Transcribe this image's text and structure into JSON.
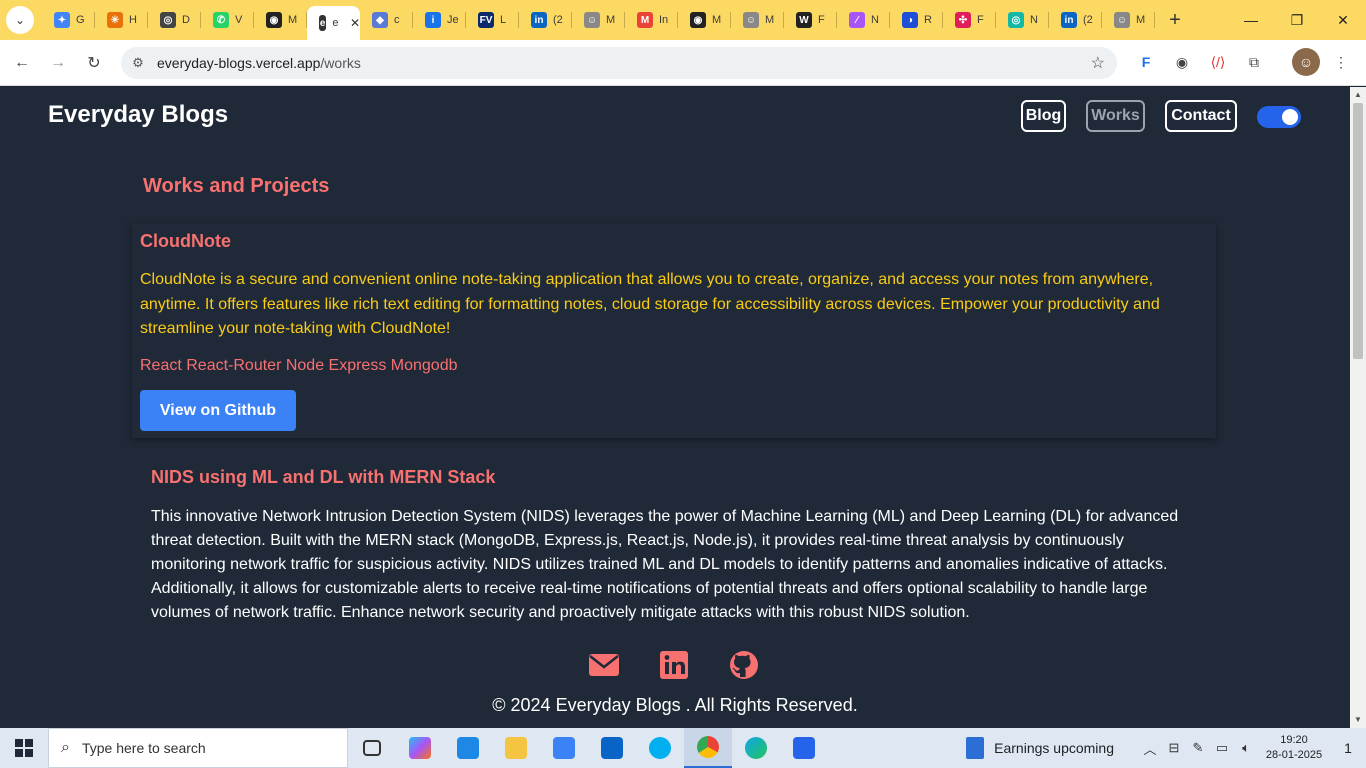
{
  "browser": {
    "tabs": [
      {
        "title": "G",
        "color": "#4285f4",
        "glyph": "✦"
      },
      {
        "title": "H",
        "color": "#e8710a",
        "glyph": "✳"
      },
      {
        "title": "D",
        "color": "#444444",
        "glyph": "◎"
      },
      {
        "title": "V",
        "color": "#25d366",
        "glyph": "✆"
      },
      {
        "title": "M",
        "color": "#222222",
        "glyph": "◉"
      },
      {
        "title": "e",
        "color": "#333333",
        "glyph": "e",
        "active": true
      },
      {
        "title": "c",
        "color": "#5a7ad6",
        "glyph": "◆"
      },
      {
        "title": "Je",
        "color": "#1a73e8",
        "glyph": "i"
      },
      {
        "title": "L",
        "color": "#0a2a6b",
        "glyph": "FV"
      },
      {
        "title": "(2",
        "color": "#0a66c2",
        "glyph": "in"
      },
      {
        "title": "M",
        "color": "#888888",
        "glyph": "☺"
      },
      {
        "title": "In",
        "color": "#ea4335",
        "glyph": "M"
      },
      {
        "title": "M",
        "color": "#222222",
        "glyph": "◉"
      },
      {
        "title": "M",
        "color": "#888888",
        "glyph": "☺"
      },
      {
        "title": "F",
        "color": "#222222",
        "glyph": "W"
      },
      {
        "title": "N",
        "color": "#a855f7",
        "glyph": "∕"
      },
      {
        "title": "R",
        "color": "#1d4ed8",
        "glyph": "◑"
      },
      {
        "title": "F",
        "color": "#e01e5a",
        "glyph": "✣"
      },
      {
        "title": "N",
        "color": "#14b8a6",
        "glyph": "◎"
      },
      {
        "title": "(2",
        "color": "#0a66c2",
        "glyph": "in"
      },
      {
        "title": "M",
        "color": "#888888",
        "glyph": "☺"
      }
    ],
    "new_tab": "+",
    "url_host": "everyday-blogs.vercel.app",
    "url_path": "/works"
  },
  "site": {
    "brand": "Everyday Blogs",
    "nav": {
      "blog": "Blog",
      "works": "Works",
      "contact": "Contact"
    },
    "section_title": "Works and Projects",
    "projects": [
      {
        "title": "CloudNote",
        "description": "CloudNote is a secure and convenient online note-taking application that allows you to create, organize, and access your notes from anywhere, anytime. It offers features like rich text editing for formatting notes, cloud storage for accessibility across devices. Empower your productivity and streamline your note-taking with CloudNote!",
        "tech": "React React-Router Node Express Mongodb",
        "button": "View on Github"
      },
      {
        "title": "NIDS using ML and DL with MERN Stack",
        "description": "This innovative Network Intrusion Detection System (NIDS) leverages the power of Machine Learning (ML) and Deep Learning (DL) for advanced threat detection. Built with the MERN stack (MongoDB, Express.js, React.js, Node.js), it provides real-time threat analysis by continuously monitoring network traffic for suspicious activity. NIDS utilizes trained ML and DL models to identify patterns and anomalies indicative of attacks. Additionally, it allows for customizable alerts to receive real-time notifications of potential threats and offers optional scalability to handle large volumes of network traffic. Enhance network security and proactively mitigate attacks with this robust NIDS solution."
      }
    ],
    "footer_copy": "© 2024 Everyday Blogs . All Rights Reserved."
  },
  "taskbar": {
    "search_placeholder": "Type here to search",
    "earnings": "Earnings upcoming",
    "time": "19:20",
    "date": "28-01-2025",
    "notifications": "1"
  }
}
